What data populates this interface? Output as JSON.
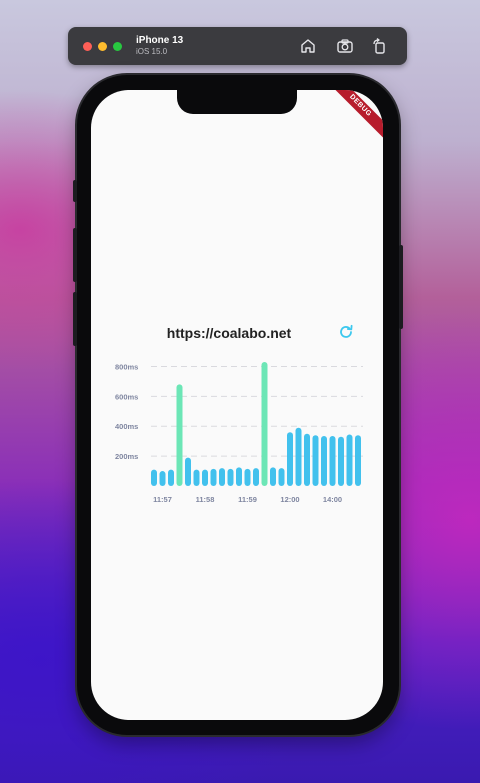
{
  "simulator": {
    "device_name": "iPhone 13",
    "os_version": "iOS 15.0",
    "icons": [
      "home-icon",
      "screenshot-icon",
      "rotate-icon"
    ]
  },
  "app": {
    "debug_banner": "DEBUG",
    "url": "https://coalabo.net",
    "refresh_icon": "refresh-icon",
    "accent_color": "#3cc8ee"
  },
  "chart_data": {
    "type": "bar",
    "y_unit": "ms",
    "y_ticks": [
      "800ms",
      "600ms",
      "400ms",
      "200ms"
    ],
    "ylim": [
      0,
      830
    ],
    "x_tick_labels": [
      "11:57",
      "11:58",
      "11:59",
      "12:00",
      "14:00"
    ],
    "x_tick_bar_index": [
      1,
      6,
      11,
      16,
      21
    ],
    "grid": "horizontal-dashed",
    "colors": {
      "low": "#42c1ed",
      "high": "#6ce6b6"
    },
    "values": [
      110,
      100,
      110,
      680,
      190,
      110,
      110,
      115,
      120,
      115,
      125,
      115,
      120,
      830,
      125,
      120,
      360,
      390,
      350,
      340,
      335,
      335,
      330,
      345,
      340
    ]
  }
}
